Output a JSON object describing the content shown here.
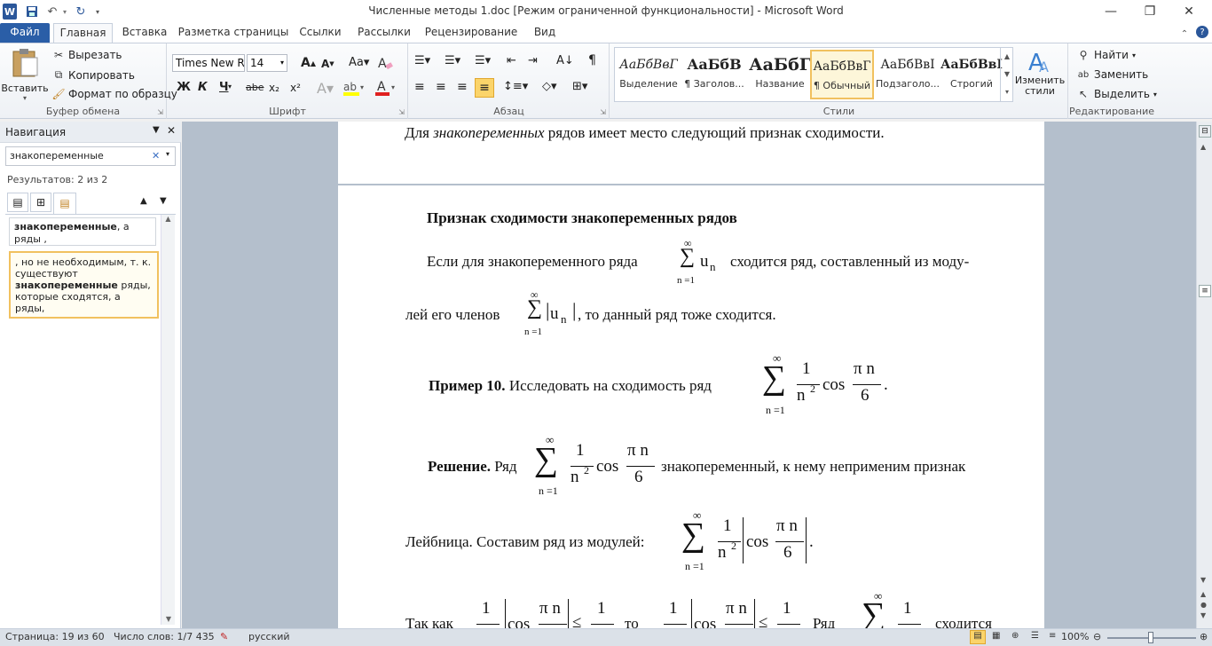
{
  "window": {
    "title": "Численные методы 1.doc [Режим ограниченной функциональности]  -  Microsoft Word"
  },
  "tabs": [
    {
      "label": "Файл"
    },
    {
      "label": "Главная"
    },
    {
      "label": "Вставка"
    },
    {
      "label": "Разметка страницы"
    },
    {
      "label": "Ссылки"
    },
    {
      "label": "Рассылки"
    },
    {
      "label": "Рецензирование"
    },
    {
      "label": "Вид"
    }
  ],
  "ribbon": {
    "clipboard": {
      "paste": "Вставить",
      "cut": "Вырезать",
      "copy": "Копировать",
      "format_painter": "Формат по образцу",
      "label": "Буфер обмена"
    },
    "font": {
      "name": "Times New Roman",
      "size": "14",
      "label": "Шрифт",
      "bold": "Ж",
      "italic": "К",
      "underline": "Ч",
      "strike": "abe",
      "sub": "x₂",
      "sup": "x²"
    },
    "paragraph": {
      "label": "Абзац"
    },
    "styles": {
      "label": "Стили",
      "items": [
        {
          "preview": "АаБбВвГ",
          "name": "Выделение"
        },
        {
          "preview": "АаБбВ",
          "name": "¶ Заголов..."
        },
        {
          "preview": "АаБбГ",
          "name": "Название"
        },
        {
          "preview": "АаБбВвГ",
          "name": "¶ Обычный"
        },
        {
          "preview": "АаБбВвІ",
          "name": "Подзаголо..."
        },
        {
          "preview": "АаБбВвІ",
          "name": "Строгий"
        }
      ],
      "change": "Изменить стили"
    },
    "editing": {
      "label": "Редактирование",
      "find": "Найти",
      "replace": "Заменить",
      "select": "Выделить"
    }
  },
  "nav": {
    "title": "Навигация",
    "search_value": "знакопеременные",
    "results": "Результатов: 2 из 2",
    "result1": {
      "bold": "знакопеременные",
      "rest": ", а ряды  ,"
    },
    "result2": {
      "pre": ", но не необходимым, т. к. существуют ",
      "bold": "знакопеременные",
      "post": " ряды, которые сходятся, а ряды,"
    }
  },
  "doc": {
    "top_line_pre": "Для ",
    "top_line_italic": "знакопеременных",
    "top_line_post": " рядов имеет место следующий признак сходимости.",
    "heading": "Признак сходимости знакопеременных рядов",
    "p1_a": "Если для знакопеременного ряда",
    "p1_b": "сходится ряд, составленный из моду-",
    "p2_a": "лей его членов",
    "p2_b": ", то данный ряд тоже сходится.",
    "ex_bold": "Пример 10.",
    "ex_text": " Исследовать на сходимость ряд",
    "sol_bold": "Решение.",
    "sol_a": " Ряд",
    "sol_b": "знакопеременный, к нему неприменим признак",
    "leib": "Лейбница. Составим ряд из модулей:",
    "last_a": "Так как",
    "last_b": "то",
    "last_c": "Ряд",
    "last_d": "сходится",
    "math": {
      "inf": "∞",
      "n1": "n =1",
      "un": "u",
      "sub_n": "n",
      "one": "1",
      "n2": "n",
      "sq": "2",
      "cos": "cos",
      "pin": "π n",
      "six": "6",
      "le": "≤",
      "dot": "."
    }
  },
  "status": {
    "page": "Страница: 19 из 60",
    "words": "Число слов: 1/7 435",
    "lang": "русский",
    "zoom": "100%"
  }
}
